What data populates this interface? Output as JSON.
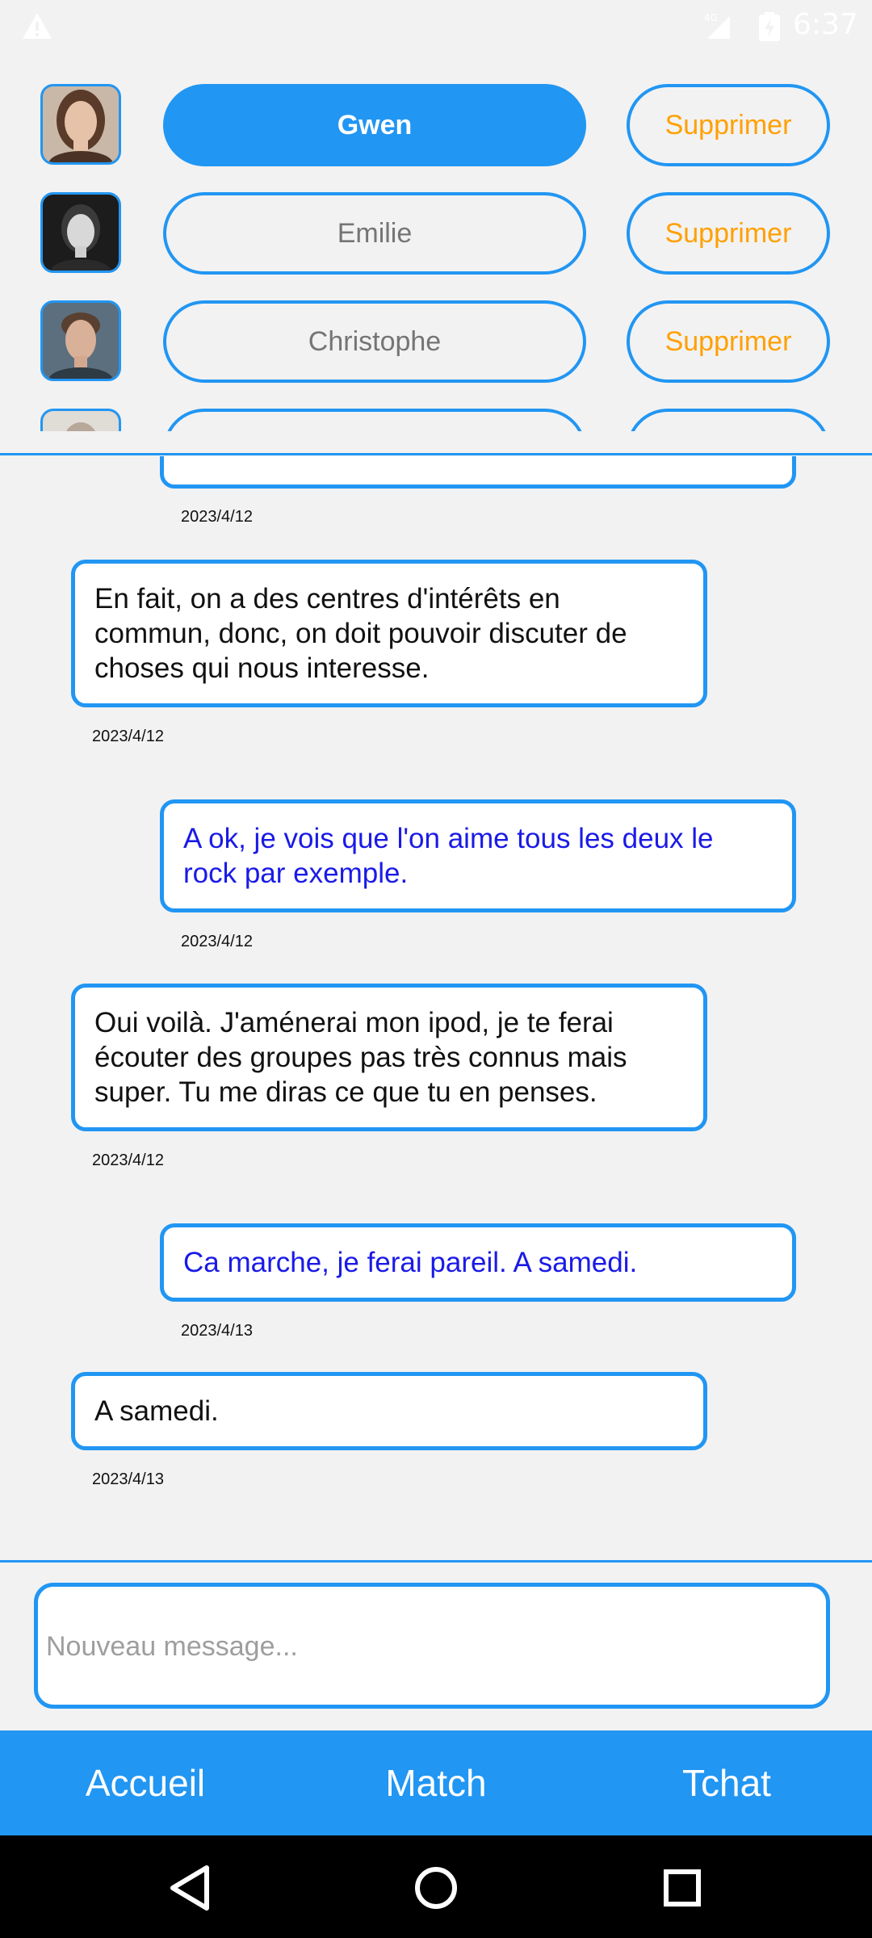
{
  "status_bar": {
    "time": "6:37",
    "network": "4G",
    "icons": [
      "warning-icon",
      "signal-icon",
      "battery-icon"
    ]
  },
  "contacts": [
    {
      "name": "Gwen",
      "delete_label": "Supprimer",
      "active": true
    },
    {
      "name": "Emilie",
      "delete_label": "Supprimer",
      "active": false
    },
    {
      "name": "Christophe",
      "delete_label": "Supprimer",
      "active": false
    }
  ],
  "messages": [
    {
      "from": "me",
      "text": "",
      "date": "2023/4/12"
    },
    {
      "from": "them",
      "text": "En fait, on a des centres d'intérêts en commun, donc, on doit pouvoir discuter de choses qui nous interesse.",
      "date": "2023/4/12"
    },
    {
      "from": "me",
      "text": "A ok, je vois que l'on aime tous les deux le rock par exemple.",
      "date": "2023/4/12"
    },
    {
      "from": "them",
      "text": "Oui voilà. J'aménerai mon ipod, je te ferai écouter des groupes pas très connus mais super. Tu me diras ce que tu en penses.",
      "date": "2023/4/12"
    },
    {
      "from": "me",
      "text": "Ca marche, je ferai pareil. A samedi.",
      "date": "2023/4/13"
    },
    {
      "from": "them",
      "text": "A samedi.",
      "date": "2023/4/13"
    }
  ],
  "composer": {
    "placeholder": "Nouveau message...",
    "value": ""
  },
  "nav": {
    "home": "Accueil",
    "match": "Match",
    "chat": "Tchat"
  },
  "colors": {
    "accent": "#2196f3",
    "delete_text": "#ffa000",
    "my_message_text": "#1a1ae6",
    "background": "#f2f2f2"
  }
}
